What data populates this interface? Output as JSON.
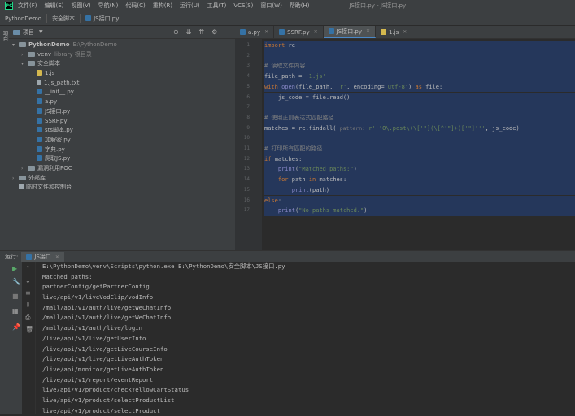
{
  "menubar": {
    "app_icon_text": "PC",
    "items": [
      "文件(F)",
      "编辑(E)",
      "视图(V)",
      "导航(N)",
      "代码(C)",
      "重构(R)",
      "运行(U)",
      "工具(T)",
      "VCS(S)",
      "窗口(W)",
      "帮助(H)"
    ],
    "window_title": "JS接口.py - JS接口.py"
  },
  "breadcrumb": {
    "project": "PythonDemo",
    "folder": "安全脚本",
    "file": "JS接口.py"
  },
  "project_panel": {
    "title": "项目",
    "strip_label": "项目",
    "toolbar_icons": [
      "target-icon",
      "collapse-icon",
      "expand-icon",
      "gear-icon",
      "minimize-icon"
    ],
    "tree": [
      {
        "label": "PythonDemo",
        "extra": "E:\\PythonDemo",
        "type": "folder",
        "indent": 0,
        "expanded": true,
        "bold": true
      },
      {
        "label": "venv",
        "extra": "library 根目录",
        "type": "folder",
        "indent": 1,
        "expanded": false
      },
      {
        "label": "安全脚本",
        "extra": "",
        "type": "folder",
        "indent": 1,
        "expanded": true
      },
      {
        "label": "1.js",
        "extra": "",
        "type": "js",
        "indent": 2
      },
      {
        "label": "1.js_path.txt",
        "extra": "",
        "type": "txt",
        "indent": 2
      },
      {
        "label": "__init__.py",
        "extra": "",
        "type": "py",
        "indent": 2
      },
      {
        "label": "a.py",
        "extra": "",
        "type": "py",
        "indent": 2
      },
      {
        "label": "JS接口.py",
        "extra": "",
        "type": "py",
        "indent": 2
      },
      {
        "label": "SSRF.py",
        "extra": "",
        "type": "py",
        "indent": 2
      },
      {
        "label": "sts脚本.py",
        "extra": "",
        "type": "py",
        "indent": 2
      },
      {
        "label": "加解密.py",
        "extra": "",
        "type": "py",
        "indent": 2
      },
      {
        "label": "字典.py",
        "extra": "",
        "type": "py",
        "indent": 2
      },
      {
        "label": "爬取JS.py",
        "extra": "",
        "type": "py",
        "indent": 2
      },
      {
        "label": "漏洞利用POC",
        "extra": "",
        "type": "folder",
        "indent": 1,
        "expanded": false
      },
      {
        "label": "外部库",
        "extra": "",
        "type": "lib",
        "indent": 0,
        "expanded": false
      },
      {
        "label": "临时文件和控制台",
        "extra": "",
        "type": "scratch",
        "indent": 0
      }
    ]
  },
  "editor": {
    "tabs": [
      {
        "label": "a.py",
        "type": "py",
        "active": false
      },
      {
        "label": "SSRF.py",
        "type": "py",
        "active": false
      },
      {
        "label": "JS接口.py",
        "type": "py",
        "active": true
      },
      {
        "label": "1.js",
        "type": "js",
        "active": false
      }
    ],
    "line_numbers": [
      "1",
      "2",
      "3",
      "4",
      "5",
      "6",
      "7",
      "8",
      "9",
      "10",
      "11",
      "12",
      "13",
      "14",
      "15",
      "16",
      "17"
    ]
  },
  "run": {
    "label": "运行:",
    "tab": "JS接口",
    "output": [
      "E:\\PythonDemo\\venv\\Scripts\\python.exe E:\\PythonDemo\\安全脚本\\JS接口.py",
      "Matched paths:",
      "partnerConfig/getPartnerConfig",
      "live/api/v1/liveVodClip/vodInfo",
      "/mall/api/v1/auth/live/getWeChatInfo",
      "/mall/api/v1/auth/live/getWeChatInfo",
      "/mall/api/v1/auth/live/login",
      "/live/api/v1/live/getUserInfo",
      "/live/api/v1/live/getLiveCourseInfo",
      "/live/api/v1/live/getLiveAuthToken",
      "/live/api/monitor/getLiveAuthToken",
      "/live/api/v1/report/eventReport",
      "live/api/v1/product/checkYellowCartStatus",
      "live/api/v1/product/selectProductList",
      "live/api/v1/product/selectProduct"
    ]
  },
  "colors": {
    "background": "#2b2b2b",
    "panel": "#3c3f41",
    "keyword": "#cc7832",
    "string": "#6a8759",
    "comment": "#808080",
    "selection": "#214283"
  }
}
